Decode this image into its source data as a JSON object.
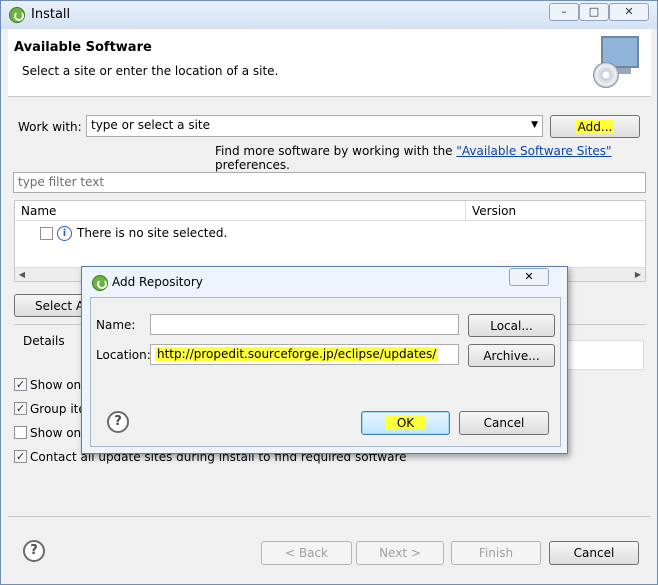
{
  "window": {
    "title": "Install",
    "controls": [
      "–",
      "□",
      "✕"
    ]
  },
  "header": {
    "title": "Available Software",
    "subtitle": "Select a site or enter the location of a site."
  },
  "work_with": {
    "label": "Work with:",
    "value": "type or select a site",
    "add_button": "Add..."
  },
  "find_more": {
    "prefix": "Find more software by working with the ",
    "link": "\"Available Software Sites\"",
    "suffix": " preferences."
  },
  "filter": {
    "placeholder": "type filter text"
  },
  "table": {
    "columns": [
      "Name",
      "Version"
    ],
    "rows": [
      {
        "label": "There is no site selected."
      }
    ]
  },
  "select_all_button": "Select Al",
  "details": {
    "label": "Details"
  },
  "options": [
    {
      "label": "Show onl",
      "checked": true
    },
    {
      "label": "Group iter",
      "checked": true
    },
    {
      "label": "Show onl",
      "checked": false
    },
    {
      "label": "Contact all update sites during install to find required software",
      "checked": true
    }
  ],
  "footer": {
    "back": "< Back",
    "next": "Next >",
    "finish": "Finish",
    "cancel": "Cancel"
  },
  "dialog": {
    "title": "Add Repository",
    "close": "✕",
    "name_label": "Name:",
    "name_value": "",
    "local_button": "Local...",
    "location_label": "Location:",
    "location_value": "http://propedit.sourceforge.jp/eclipse/updates/",
    "archive_button": "Archive...",
    "ok": "OK",
    "cancel": "Cancel"
  },
  "colors": {
    "highlight": "#ffff3a",
    "link": "#0b46a8"
  }
}
